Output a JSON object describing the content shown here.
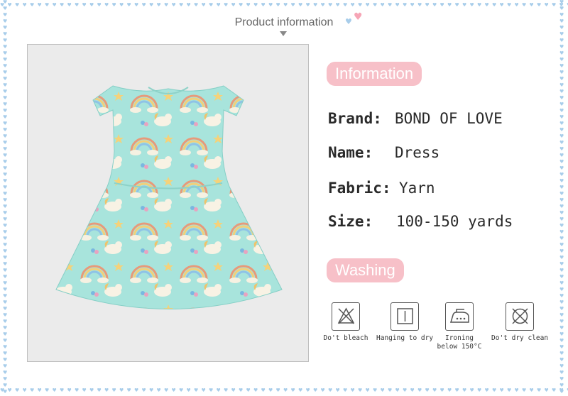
{
  "header": {
    "title": "Product information"
  },
  "sections": {
    "information_label": "Information",
    "washing_label": "Washing"
  },
  "specs": [
    {
      "key": "Brand:",
      "value": "BOND OF LOVE"
    },
    {
      "key": "Name:",
      "value": "Dress"
    },
    {
      "key": "Fabric:",
      "value": "Yarn"
    },
    {
      "key": "Size:",
      "value": "100-150 yards"
    }
  ],
  "care": [
    {
      "label": "Do't bleach",
      "icon": "no-bleach-icon"
    },
    {
      "label": "Hanging to dry",
      "icon": "hang-dry-icon"
    },
    {
      "label": "Ironing below 150°C",
      "label_line1": "Ironing",
      "label_line2": "below 150°C",
      "icon": "iron-icon"
    },
    {
      "label": "Do't dry clean",
      "icon": "no-dry-clean-icon"
    }
  ],
  "colors": {
    "pill": "#f7c0c8",
    "border_hearts": "#a8cdea",
    "dress": "#a8e4dc"
  }
}
